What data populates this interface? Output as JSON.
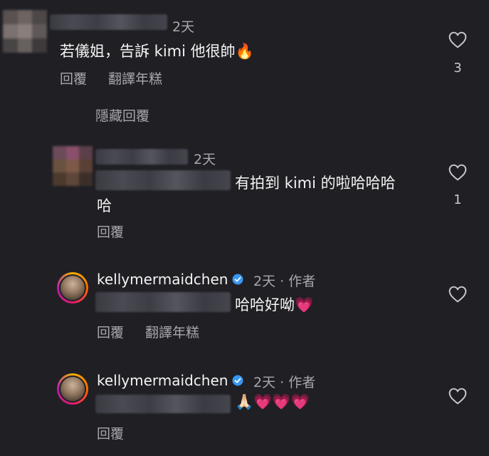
{
  "comments": [
    {
      "time": "2天",
      "text": "若儀姐，告訴 kimi 他很帥🔥",
      "reply_label": "回覆",
      "translate_label": "翻譯年糕",
      "likes": "3"
    },
    {
      "hide_replies_label": "隱藏回覆"
    },
    {
      "time": "2天",
      "text_line1": "有拍到 kimi 的啦哈哈哈",
      "text_line2": "哈",
      "reply_label": "回覆",
      "likes": "1"
    },
    {
      "username": "kellymermaidchen",
      "time_author": "2天 · 作者",
      "text": "哈哈好呦💗",
      "reply_label": "回覆",
      "translate_label": "翻譯年糕"
    },
    {
      "username": "kellymermaidchen",
      "time_author": "2天 · 作者",
      "text": "🙏🏻💗💗💗",
      "reply_label": "回覆"
    }
  ],
  "colors": {
    "background": "#1f1f24",
    "muted_text": "#a7a7ae",
    "verified_blue": "#3897f0"
  },
  "icons": {
    "like": "heart-outline-icon",
    "verified": "verified-badge-icon"
  }
}
